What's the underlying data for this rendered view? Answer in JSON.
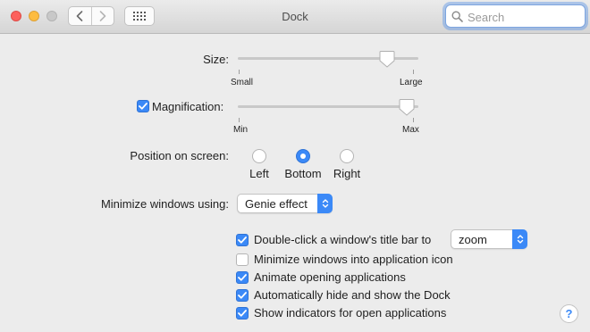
{
  "window": {
    "title": "Dock"
  },
  "search": {
    "placeholder": "Search"
  },
  "size": {
    "label": "Size:",
    "min_label": "Small",
    "max_label": "Large",
    "value_fraction": 0.86
  },
  "magnification": {
    "label": "Magnification:",
    "checked": true,
    "min_label": "Min",
    "max_label": "Max",
    "value_fraction": 0.98
  },
  "position": {
    "label": "Position on screen:",
    "options": [
      {
        "label": "Left",
        "selected": false
      },
      {
        "label": "Bottom",
        "selected": true
      },
      {
        "label": "Right",
        "selected": false
      }
    ]
  },
  "minimize": {
    "label": "Minimize windows using:",
    "value": "Genie effect"
  },
  "options": [
    {
      "label": "Double-click a window's title bar to",
      "checked": true,
      "popup": "zoom"
    },
    {
      "label": "Minimize windows into application icon",
      "checked": false
    },
    {
      "label": "Animate opening applications",
      "checked": true
    },
    {
      "label": "Automatically hide and show the Dock",
      "checked": true
    },
    {
      "label": "Show indicators for open applications",
      "checked": true
    }
  ],
  "help": {
    "label": "?"
  },
  "colors": {
    "accent": "#3b89f7",
    "close": "#fc605c",
    "minimize": "#fdbc40"
  }
}
